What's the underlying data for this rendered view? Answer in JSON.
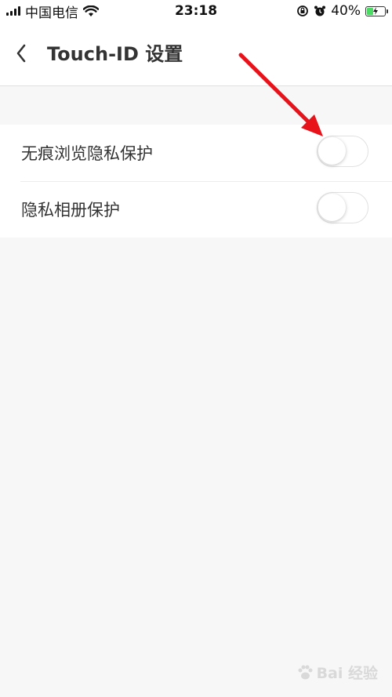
{
  "status_bar": {
    "carrier": "中国电信",
    "time": "23:18",
    "battery_percent": "40%",
    "battery_level": 0.4,
    "icons": [
      "signal-icon",
      "wifi-icon",
      "orientation-lock-icon",
      "alarm-icon",
      "battery-charging-icon"
    ]
  },
  "nav": {
    "back_icon": "chevron-left-icon",
    "title": "Touch-ID 设置"
  },
  "settings": [
    {
      "label": "无痕浏览隐私保护",
      "enabled": false
    },
    {
      "label": "隐私相册保护",
      "enabled": false
    }
  ],
  "annotation": {
    "color": "#e8121b"
  },
  "watermark": {
    "text": "Bai 经验"
  }
}
